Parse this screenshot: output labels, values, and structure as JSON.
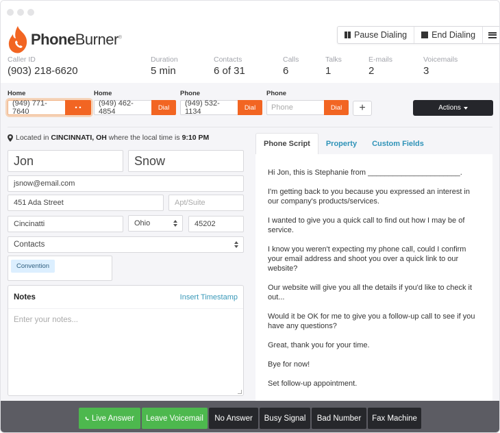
{
  "window": {
    "controls": [
      "close",
      "minimize",
      "maximize"
    ]
  },
  "brand": {
    "name_bold": "Phone",
    "name_light": "Burner",
    "reg": "®",
    "color": "#f26522"
  },
  "header": {
    "caller_id": {
      "label": "Caller ID",
      "value": "(903) 218-6620"
    },
    "stats": [
      {
        "label": "Duration",
        "value": "5 min"
      },
      {
        "label": "Contacts",
        "value": "6 of 31"
      },
      {
        "label": "Calls",
        "value": "6"
      },
      {
        "label": "Talks",
        "value": "1"
      },
      {
        "label": "E-mails",
        "value": "2"
      },
      {
        "label": "Voicemails",
        "value": "3"
      }
    ],
    "controls": {
      "pause": "Pause Dialing",
      "end": "End Dialing",
      "menu_icon": "list-icon"
    }
  },
  "phones": [
    {
      "label": "Home",
      "value": "(949) 771-7640",
      "button": "• •",
      "active": true
    },
    {
      "label": "Home",
      "value": "(949) 462-4854",
      "button": "Dial"
    },
    {
      "label": "Phone",
      "value": "(949) 532-1134",
      "button": "Dial"
    },
    {
      "label": "Phone",
      "value": "",
      "placeholder": "Phone",
      "button": "Dial"
    }
  ],
  "add_phone": "+",
  "actions": {
    "label": "Actions"
  },
  "location": {
    "prefix": "Located in ",
    "city": "CINCINNATI, OH",
    "middle": " where the local time is ",
    "time": "9:10 PM"
  },
  "contact": {
    "first_name": "Jon",
    "last_name": "Snow",
    "email": "jsnow@email.com",
    "address": "451 Ada Street",
    "apt_placeholder": "Apt/Suite",
    "city": "Cincinatti",
    "state": "Ohio",
    "zip": "45202",
    "folder": "Contacts",
    "tags": [
      "Convention"
    ]
  },
  "notes": {
    "title": "Notes",
    "insert_timestamp": "Insert Timestamp",
    "placeholder": "Enter your notes..."
  },
  "tabs": [
    {
      "label": "Phone Script",
      "active": true
    },
    {
      "label": "Property"
    },
    {
      "label": "Custom Fields"
    }
  ],
  "script": [
    "Hi Jon, this is Stephanie from ______________________.",
    "I'm getting back to you because you expressed an interest in our company's products/services.",
    "I wanted to give you a quick call to find out how I may be of service.",
    "I know you weren't expecting my phone call, could I confirm your email address and shoot you over a quick link to our website?",
    "Our website will give you all the details if you'd like to check it out...",
    "Would it be OK for me to give you a follow-up call to see if you have any questions?",
    "Great, thank you for your time.",
    "Bye for now!",
    "Set follow-up appointment."
  ],
  "dispositions": [
    {
      "label": "Live Answer",
      "style": "green",
      "icon": "phone-icon"
    },
    {
      "label": "Leave Voicemail",
      "style": "green"
    },
    {
      "label": "No Answer",
      "style": "dark"
    },
    {
      "label": "Busy Signal",
      "style": "dark"
    },
    {
      "label": "Bad Number",
      "style": "dark"
    },
    {
      "label": "Fax Machine",
      "style": "dark"
    }
  ]
}
